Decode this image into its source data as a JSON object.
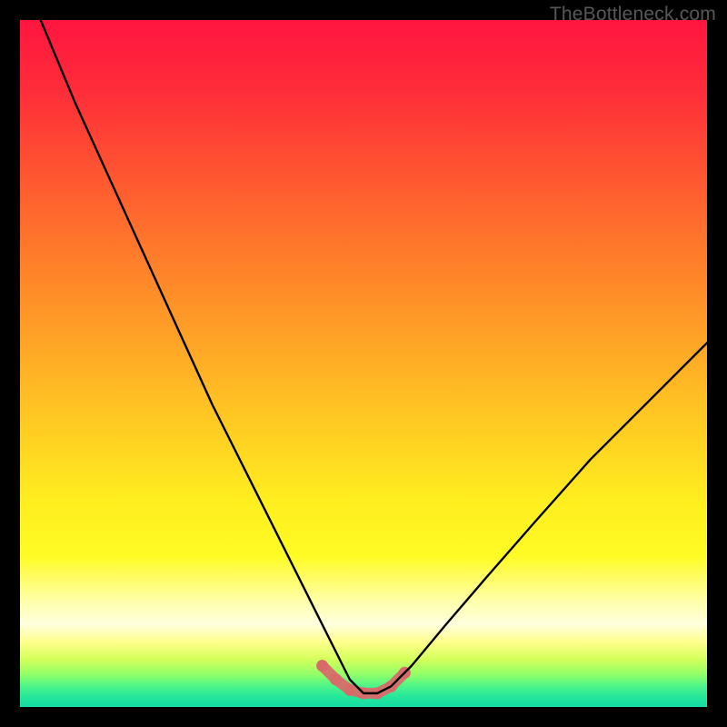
{
  "watermark": {
    "text": "TheBottleneck.com"
  },
  "gradient": {
    "stops": [
      {
        "offset": 0.0,
        "color": "#ff153e"
      },
      {
        "offset": 0.1,
        "color": "#ff2c3a"
      },
      {
        "offset": 0.22,
        "color": "#ff5431"
      },
      {
        "offset": 0.34,
        "color": "#ff7b2a"
      },
      {
        "offset": 0.46,
        "color": "#ffa126"
      },
      {
        "offset": 0.58,
        "color": "#ffc822"
      },
      {
        "offset": 0.7,
        "color": "#ffee20"
      },
      {
        "offset": 0.78,
        "color": "#fffb24"
      },
      {
        "offset": 0.845,
        "color": "#ffffa8"
      },
      {
        "offset": 0.88,
        "color": "#ffffdf"
      },
      {
        "offset": 0.905,
        "color": "#ffff8e"
      },
      {
        "offset": 0.93,
        "color": "#d6ff5b"
      },
      {
        "offset": 0.952,
        "color": "#94ff68"
      },
      {
        "offset": 0.97,
        "color": "#4cf58a"
      },
      {
        "offset": 0.985,
        "color": "#25e79a"
      },
      {
        "offset": 1.0,
        "color": "#14dca6"
      }
    ]
  },
  "curve": {
    "stroke": "#000000",
    "strokeWidth": 2.4,
    "valley_highlight": {
      "color": "#d86a6a",
      "width": 12
    }
  },
  "chart_data": {
    "type": "line",
    "title": "",
    "xlabel": "",
    "ylabel": "",
    "xlim": [
      0,
      100
    ],
    "ylim": [
      0,
      100
    ],
    "grid": false,
    "annotations": [
      "TheBottleneck.com"
    ],
    "series": [
      {
        "name": "bottleneck-curve",
        "description": "V-shaped bottleneck curve; lower is better. Estimated points (x = relative position %, y = bottleneck %).",
        "x": [
          3,
          8,
          13,
          18,
          23,
          28,
          33,
          38,
          43,
          46,
          48,
          50,
          52,
          54,
          57,
          62,
          68,
          75,
          83,
          92,
          100
        ],
        "y": [
          100,
          88,
          77,
          66,
          55,
          44,
          34,
          24,
          14,
          8,
          4,
          2,
          2,
          3,
          6,
          12,
          19,
          27,
          36,
          45,
          53
        ]
      },
      {
        "name": "optimal-zone-highlight",
        "description": "Pink highlighted segment at valley floor indicating optimal (lowest bottleneck) region.",
        "x": [
          44,
          46,
          48,
          50,
          52,
          54,
          56
        ],
        "y": [
          6,
          4,
          2.5,
          2,
          2,
          3,
          5
        ]
      }
    ]
  }
}
